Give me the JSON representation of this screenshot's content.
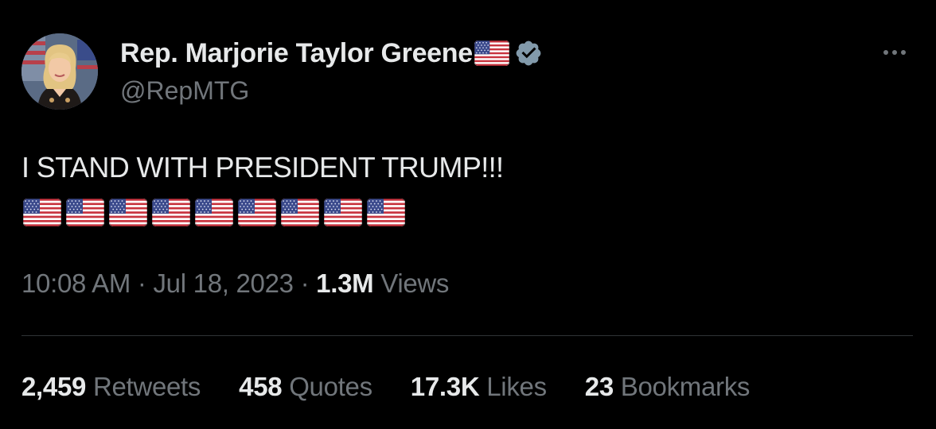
{
  "author": {
    "display_name": "Rep. Marjorie Taylor Greene",
    "handle": "@RepMTG",
    "name_emoji": "us-flag",
    "verified_color": "#829aab"
  },
  "tweet": {
    "text": "I STAND WITH PRESIDENT TRUMP!!!",
    "flag_emoji": "us-flag",
    "flag_count": 9
  },
  "meta": {
    "time": "10:08 AM",
    "separator": "·",
    "date": "Jul 18, 2023",
    "views_count": "1.3M",
    "views_label": "Views"
  },
  "stats": [
    {
      "count": "2,459",
      "label": "Retweets"
    },
    {
      "count": "458",
      "label": "Quotes"
    },
    {
      "count": "17.3K",
      "label": "Likes"
    },
    {
      "count": "23",
      "label": "Bookmarks"
    }
  ],
  "colors": {
    "background": "#000000",
    "text_primary": "#e7e9ea",
    "text_secondary": "#71767b",
    "divider": "#2f3336"
  },
  "icons": {
    "more": "more-horizontal-icon",
    "verified": "verified-badge-icon"
  }
}
